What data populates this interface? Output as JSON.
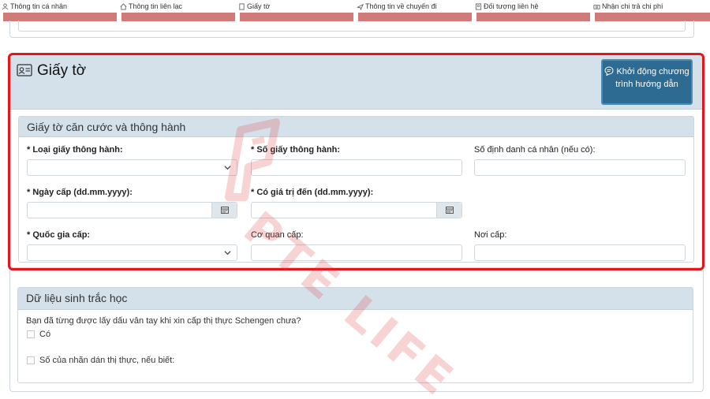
{
  "tabs": [
    {
      "label": "Thông tin cá nhân",
      "icon": "person-icon"
    },
    {
      "label": "Thông tin liên lạc",
      "icon": "home-icon"
    },
    {
      "label": "Giấy tờ",
      "icon": "document-icon"
    },
    {
      "label": "Thông tin về chuyến đi",
      "icon": "plane-icon"
    },
    {
      "label": "Đối tượng liên hệ",
      "icon": "contact-icon"
    },
    {
      "label": "Nhận chi trả chi phí",
      "icon": "money-icon"
    }
  ],
  "documents": {
    "title": "Giấy tờ",
    "guide_button": "Khởi động chương trình hướng dẫn",
    "id_panel": {
      "title": "Giấy tờ căn cước và thông hành",
      "fields": {
        "travel_doc_type": {
          "label": "* Loại giấy thông hành:",
          "value": ""
        },
        "travel_doc_number": {
          "label": "* Số giấy thông hành:",
          "value": ""
        },
        "personal_id": {
          "label": "Số định danh cá nhân (nếu có):",
          "value": ""
        },
        "issue_date": {
          "label": "* Ngày cấp (dd.mm.yyyy):",
          "value": ""
        },
        "valid_until": {
          "label": "* Có giá trị đến (dd.mm.yyyy):",
          "value": ""
        },
        "issuing_country": {
          "label": "* Quốc gia cấp:",
          "value": ""
        },
        "issuing_authority": {
          "label": "Cơ quan cấp:",
          "value": ""
        },
        "place_of_issue": {
          "label": "Nơi cấp:",
          "value": ""
        }
      }
    }
  },
  "biometrics": {
    "title": "Dữ liệu sinh trắc học",
    "question": "Bạn đã từng được lấy dấu vân tay khi xin cấp thị thực Schengen chưa?",
    "option_yes": "Có",
    "option_visa_sticker": "Số của nhãn dán thị thực, nếu biết:",
    "checked_yes": false,
    "checked_visa_sticker": false
  },
  "watermark": {
    "text": "PTE LIFE"
  },
  "colors": {
    "header_bg": "#d4e1ea",
    "button_bg": "#2e6b93",
    "highlight": "#e8141a",
    "tab_bar": "#d07a7a"
  }
}
